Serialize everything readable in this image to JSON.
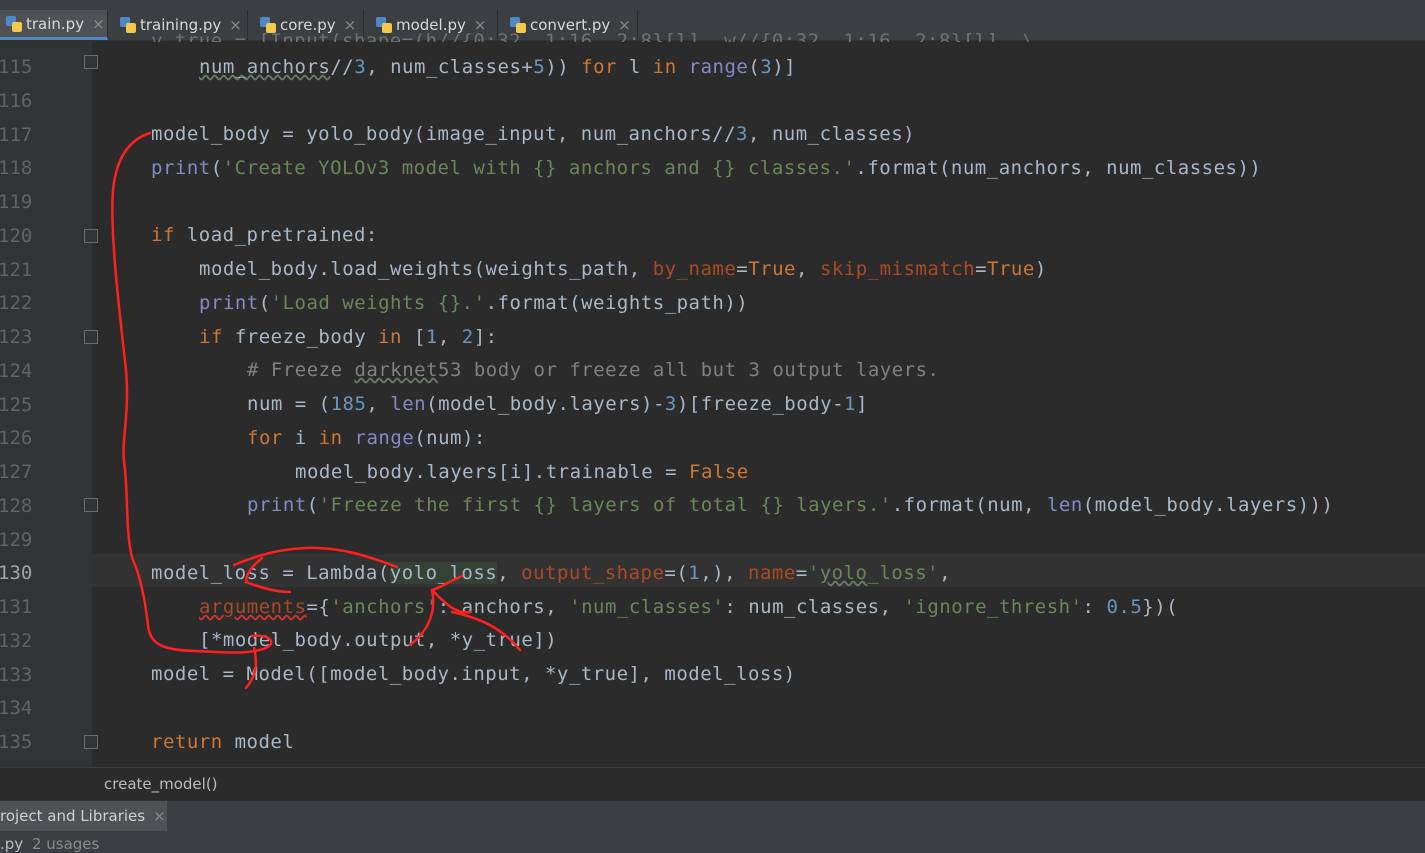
{
  "tabs": [
    {
      "label": "train.py",
      "active": true
    },
    {
      "label": "training.py",
      "active": false
    },
    {
      "label": "core.py",
      "active": false
    },
    {
      "label": "model.py",
      "active": false
    },
    {
      "label": "convert.py",
      "active": false
    }
  ],
  "tab_close": "×",
  "line_numbers": [
    "115",
    "116",
    "117",
    "118",
    "119",
    "120",
    "121",
    "122",
    "123",
    "124",
    "125",
    "126",
    "127",
    "128",
    "129",
    "130",
    "131",
    "132",
    "133",
    "134",
    "135"
  ],
  "current_line": "130",
  "code_top": "num_anchors//3, num_classes+5)) for l in range(3)]",
  "breadcrumb": "create_model()",
  "bottom_panel": {
    "tab_label": "roject and Libraries",
    "close": "×",
    "usage_file": ".py",
    "usage_count": "2 usages"
  },
  "colors": {
    "background": "#2b2b2b",
    "gutter": "#313335",
    "keyword": "#cc7832",
    "string": "#6a8759",
    "number": "#6897bb",
    "annotation": "#ff2020"
  }
}
